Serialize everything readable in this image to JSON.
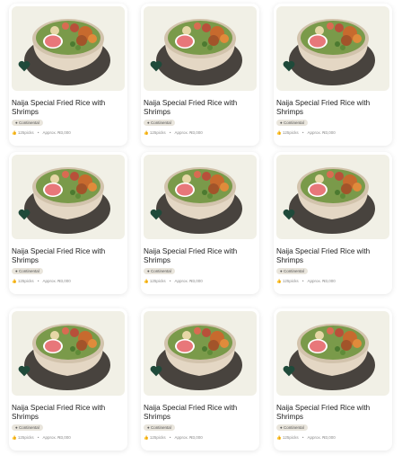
{
  "meals": [
    {
      "title": "Naija Special Fried Rice with Shrimps",
      "tag": "Continental",
      "picks": "125picks",
      "price": "Approx. ₦3,000"
    },
    {
      "title": "Naija Special Fried Rice with Shrimps",
      "tag": "Continental",
      "picks": "125picks",
      "price": "Approx. ₦3,000"
    },
    {
      "title": "Naija Special Fried Rice with Shrimps",
      "tag": "Continental",
      "picks": "125picks",
      "price": "Approx. ₦3,000"
    },
    {
      "title": "Naija Special Fried Rice with Shrimps",
      "tag": "Continental",
      "picks": "125picks",
      "price": "Approx. ₦3,000"
    },
    {
      "title": "Naija Special Fried Rice with Shrimps",
      "tag": "Continental",
      "picks": "125picks",
      "price": "Approx. ₦3,000"
    },
    {
      "title": "Naija Special Fried Rice with Shrimps",
      "tag": "Continental",
      "picks": "125picks",
      "price": "Approx. ₦3,000"
    },
    {
      "title": "Naija Special Fried Rice with Shrimps",
      "tag": "Continental",
      "picks": "125picks",
      "price": "Approx. ₦3,000"
    },
    {
      "title": "Naija Special Fried Rice with Shrimps",
      "tag": "Continental",
      "picks": "125picks",
      "price": "Approx. ₦3,000"
    },
    {
      "title": "Naija Special Fried Rice with Shrimps",
      "tag": "Continental",
      "picks": "125picks",
      "price": "Approx. ₦3,000"
    }
  ],
  "icons": {
    "favorite": "heart-icon",
    "picks": "thumbs-up-icon"
  },
  "colors": {
    "card_bg": "#ffffff",
    "thumb_bg": "#f1f0e6",
    "heart": "#1f4a3a",
    "tag_bg": "#e9e5dc"
  }
}
